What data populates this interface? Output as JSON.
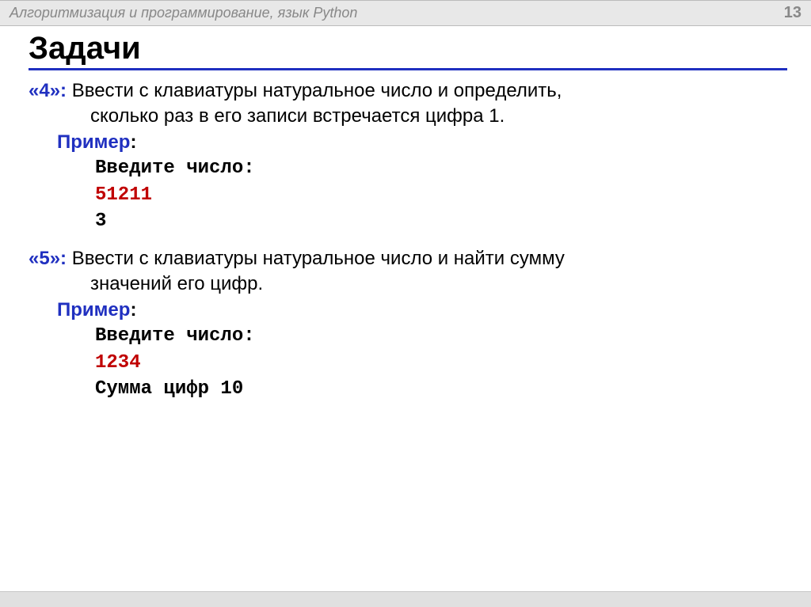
{
  "header": {
    "title": "Алгоритмизация и программирование, язык Python",
    "page": "13"
  },
  "title": "Задачи",
  "tasks": [
    {
      "grade": "«4»:",
      "desc_first": " Ввести с клавиатуры натуральное число и определить,",
      "desc_cont": "сколько  раз в его записи встречается цифра 1.",
      "example_label": "Пример",
      "colon": ":",
      "code": {
        "prompt": "Введите число:",
        "input": "51211",
        "output": "3"
      }
    },
    {
      "grade": "«5»:",
      "desc_first": " Ввести с клавиатуры натуральное число и найти сумму",
      "desc_cont": "значений его цифр.",
      "example_label": "Пример",
      "colon": ":",
      "code": {
        "prompt": "Введите число:",
        "input": "1234",
        "output": "Сумма цифр 10"
      }
    }
  ]
}
